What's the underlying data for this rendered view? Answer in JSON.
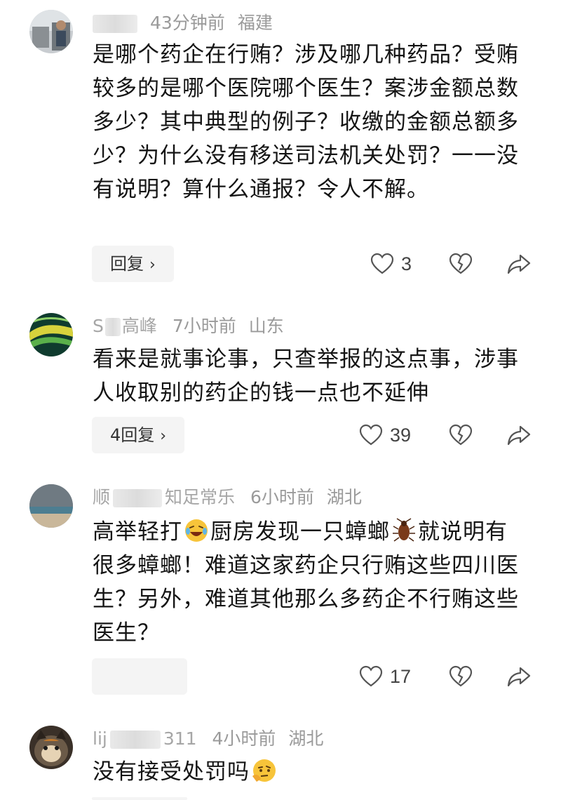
{
  "comments": [
    {
      "username": "",
      "time": "43分钟前",
      "location": "福建",
      "text": "是哪个药企在行贿？涉及哪几种药品？受贿较多的是哪个医院哪个医生？案涉金额总数多少？其中典型的例子？收缴的金额总额多少？为什么没有移送司法机关处罚？一一没有说明？算什么通报？令人不解。",
      "reply_label": "回复",
      "likes": "3"
    },
    {
      "username": "S",
      "username_suffix": "高峰",
      "time": "7小时前",
      "location": "山东",
      "text": "看来是就事论事，只查举报的这点事，涉事人收取别的药企的钱一点也不延伸",
      "reply_label": "4回复",
      "likes": "39"
    },
    {
      "username": "顺",
      "username_suffix": "知足常乐",
      "time": "6小时前",
      "location": "湖北",
      "text_part1": "高举轻打",
      "text_part2": "厨房发现一只蟑螂",
      "text_part3": "就说明有很多蟑螂！难道这家药企只行贿这些四川医生？另外，难道其他那么多药企不行贿这些医生？",
      "reply_label": "",
      "likes": "17"
    },
    {
      "username": "lij",
      "username_suffix": "311",
      "time": "4小时前",
      "location": "湖北",
      "text": "没有接受处罚吗"
    }
  ],
  "icons": {
    "like": "heart-outline-icon",
    "dislike": "broken-heart-icon",
    "share": "share-arrow-icon",
    "chevron": "chevron-right-icon"
  },
  "colors": {
    "meta_text": "#9a9a9a",
    "body_text": "#141414",
    "reply_bg": "#f4f4f4"
  }
}
